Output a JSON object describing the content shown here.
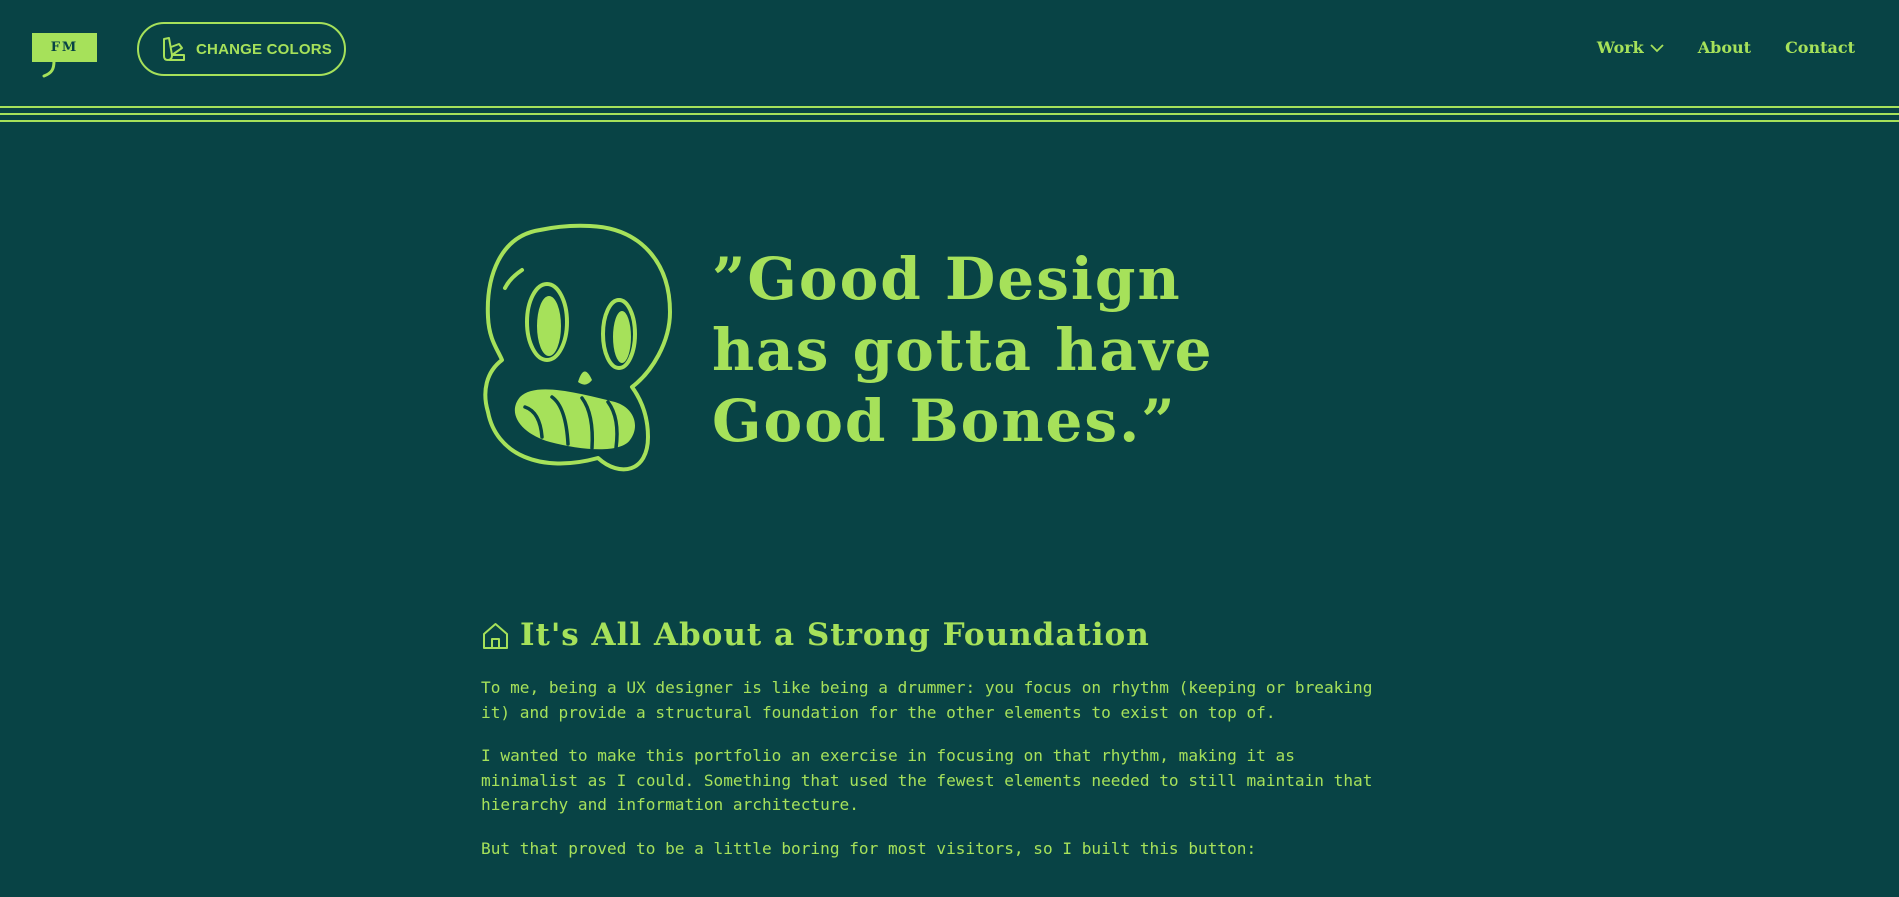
{
  "colors": {
    "background": "#084345",
    "accent": "#a6e15a"
  },
  "header": {
    "logo_text": "FM",
    "change_colors": {
      "icon": "swatch-icon",
      "label": "CHANGE COLORS"
    },
    "nav": {
      "work": "Work",
      "work_icon": "chevron-down-icon",
      "about": "About",
      "contact": "Contact"
    }
  },
  "hero": {
    "illustration": "skull-icon",
    "quote_lines": [
      "”Good Design",
      "has gotta have",
      "Good Bones.”"
    ]
  },
  "section": {
    "icon": "home-icon",
    "title": "It's All About a Strong Foundation",
    "paragraphs": [
      "To me, being a UX designer is like being a drummer: you focus on rhythm (keeping or breaking it) and provide a structural foundation for the other elements to exist on top of.",
      "I wanted to make this portfolio an exercise in focusing on that rhythm, making it as minimalist as I could. Something that used the fewest elements needed to still maintain that hierarchy and information architecture.",
      "But that proved to be a little boring for most visitors, so I built this button:"
    ]
  }
}
